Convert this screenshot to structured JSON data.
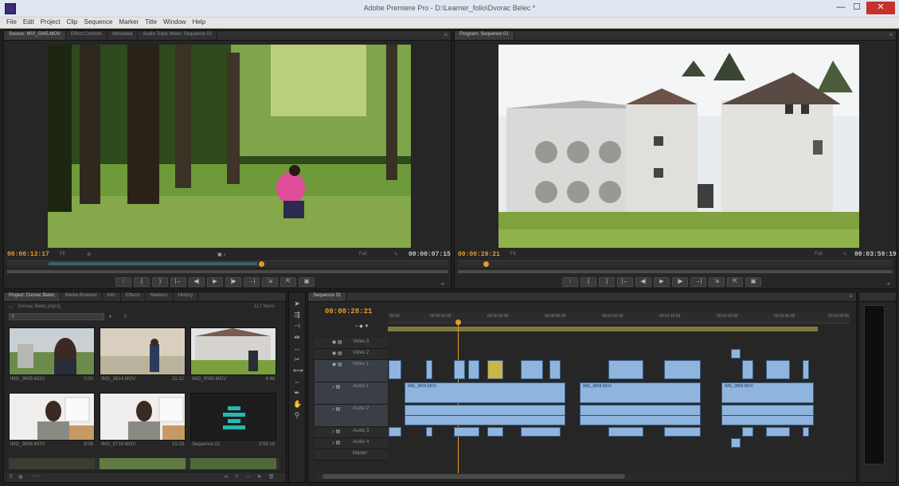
{
  "window": {
    "title": "Adobe Premiere Pro - D:\\Learner_folio\\Dvorac Belec *",
    "min_glyph": "—",
    "max_glyph": "☐",
    "close_glyph": "✕"
  },
  "menu": [
    "File",
    "Edit",
    "Project",
    "Clip",
    "Sequence",
    "Marker",
    "Title",
    "Window",
    "Help"
  ],
  "source_monitor": {
    "tabs": [
      "Source: MVI_0345.MOV",
      "Effect Controls",
      "Metadata",
      "Audio Track Mixer: Sequence 01"
    ],
    "timecode": "00:00:13:17",
    "fit": "Fit",
    "duration": "00:00:07:15"
  },
  "program_monitor": {
    "tabs": [
      "Program: Sequence 01"
    ],
    "timecode": "00:00:28:21",
    "fit": "Fit",
    "duration": "00:03:59:19"
  },
  "transport_buttons": [
    "⁝",
    "{",
    "}",
    "|←",
    "◀|",
    "▶",
    "|▶",
    "→|",
    "⇲",
    "⇱",
    "▣"
  ],
  "project": {
    "tabs": [
      "Project: Dvorac Belec",
      "Media Browser",
      "Info",
      "Effects",
      "Markers",
      "History"
    ],
    "path": "Dvorac Belec.prproj",
    "items_count": "117 Items",
    "thumbs": [
      {
        "name": "IMG_9809.MOV",
        "duration": "0:00"
      },
      {
        "name": "IMG_9814.MOV",
        "duration": "21:12"
      },
      {
        "name": "IMG_0089.MOV",
        "duration": "4:48"
      },
      {
        "name": "IMG_9698.MOV",
        "duration": "9:08"
      },
      {
        "name": "IMG_9719.MOV",
        "duration": "15:19"
      },
      {
        "name": "Sequence 01",
        "duration": "3:59:19"
      }
    ]
  },
  "timeline": {
    "tab": "Sequence 01",
    "timecode": "00:00:28:21",
    "ruler": [
      "00:00",
      "00:00:15:00",
      "00:00:30:00",
      "00:00:45:00",
      "00:01:00:00",
      "00:01:15:00",
      "00:01:30:00",
      "00:01:45:00",
      "00:02:00:00",
      "00:02:15:00"
    ],
    "tracks": [
      {
        "label": "Video 3",
        "id": "V3"
      },
      {
        "label": "Video 2",
        "id": "V2"
      },
      {
        "label": "Video 1",
        "id": "V1"
      },
      {
        "label": "Audio 1",
        "id": "A1"
      },
      {
        "label": "Audio 2",
        "id": "A2"
      },
      {
        "label": "Audio 3",
        "id": "A3"
      },
      {
        "label": "Audio 4",
        "id": "A4"
      },
      {
        "label": "Master",
        "id": "M"
      }
    ],
    "clip_label": "IMG_9809.MOV"
  },
  "colors": {
    "accent": "#e69a2a",
    "clip": "#8fb5de",
    "panel": "#262626"
  }
}
